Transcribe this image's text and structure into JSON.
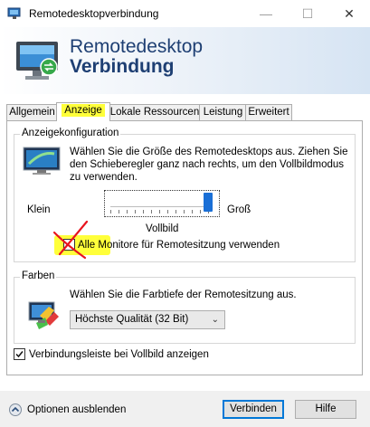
{
  "window": {
    "title": "Remotedesktopverbindung",
    "minimize": "—",
    "maximize": "☐",
    "close": "✕"
  },
  "header": {
    "line1": "Remotedesktop",
    "line2": "Verbindung"
  },
  "tabs": [
    {
      "label": "Allgemein",
      "active": false
    },
    {
      "label": "Anzeige",
      "active": true
    },
    {
      "label": "Lokale Ressourcen",
      "active": false
    },
    {
      "label": "Leistung",
      "active": false
    },
    {
      "label": "Erweitert",
      "active": false
    }
  ],
  "display": {
    "legend": "Anzeigekonfiguration",
    "description": "Wählen Sie die Größe des Remotedesktops aus. Ziehen Sie den Schieberegler ganz nach rechts, um den Vollbildmodus zu verwenden.",
    "slider_min_label": "Klein",
    "slider_max_label": "Groß",
    "slider_value_label": "Vollbild",
    "slider_fraction": 1.0,
    "multimon_label_part1": "Alle",
    "multimon_label_part2": " Monitore für Remotesitzung verwenden",
    "multimon_checked": false
  },
  "colors": {
    "legend": "Farben",
    "description": "Wählen Sie die Farbtiefe der Remotesitzung aus.",
    "depth_selected": "Höchste Qualität (32 Bit)"
  },
  "connection_bar": {
    "label": "Verbindungsleiste bei Vollbild anzeigen",
    "checked": true
  },
  "footer": {
    "options_label": "Optionen ausblenden",
    "connect_label": "Verbinden",
    "help_label": "Hilfe"
  },
  "annotation": {
    "highlight_color": "#ffff3a",
    "mark_color": "#e8141e"
  }
}
